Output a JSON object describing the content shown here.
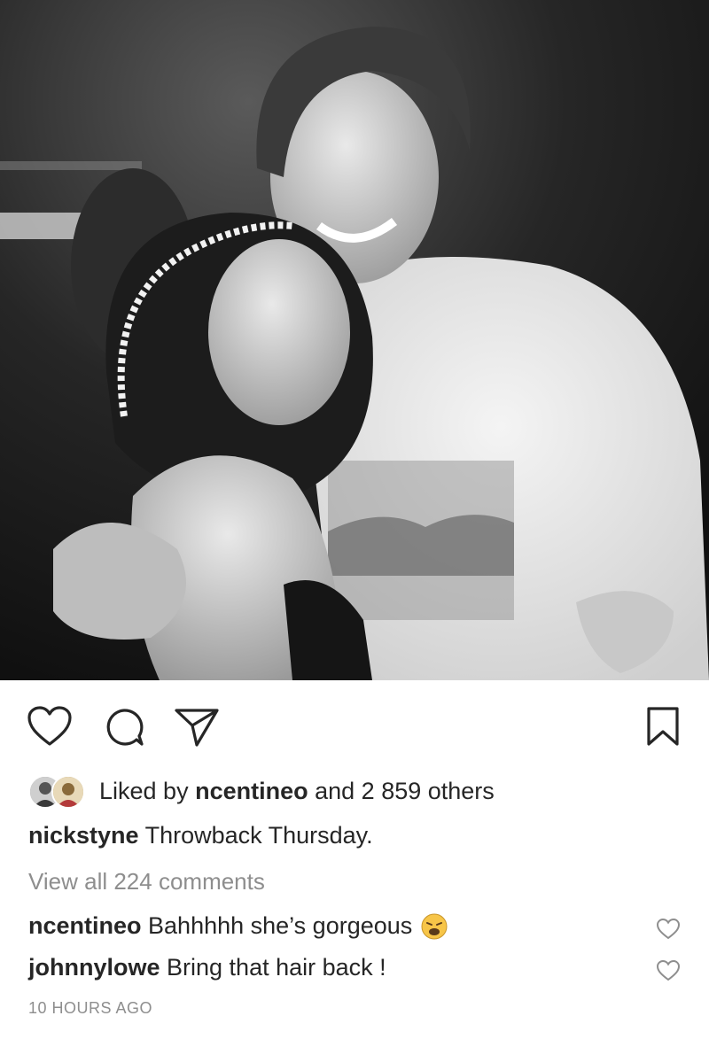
{
  "post": {
    "liked_prefix": "Liked by",
    "liked_user": "ncentineo",
    "liked_suffix": "and 2 859 others",
    "caption_user": "nickstyne",
    "caption_text": "Throwback Thursday.",
    "view_all": "View all 224 comments",
    "comments": [
      {
        "user": "ncentineo",
        "text": "Bahhhhh she’s gorgeous",
        "emoji": "weary-face-emoji"
      },
      {
        "user": "johnnylowe",
        "text": "Bring that hair back !"
      }
    ],
    "timestamp": "10 HOURS AGO"
  },
  "icons": {
    "like": "heart-icon",
    "comment": "comment-icon",
    "share": "send-icon",
    "save": "bookmark-icon"
  },
  "colors": {
    "text": "#262626",
    "muted": "#8e8e8e"
  }
}
